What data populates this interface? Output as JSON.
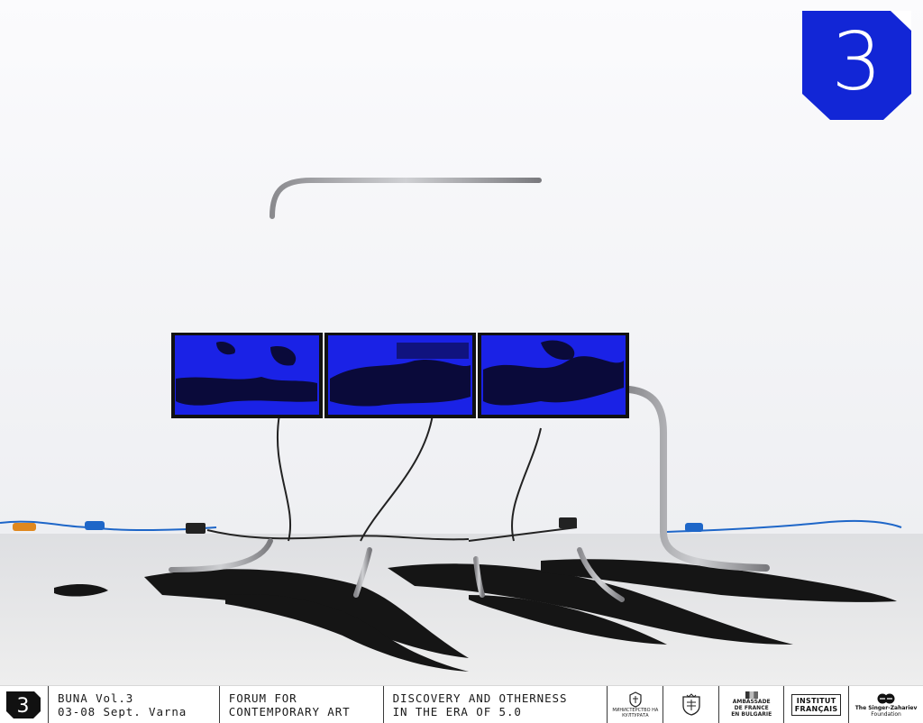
{
  "badge": {
    "number": "3",
    "color": "#1226d6"
  },
  "footer": {
    "logo_number": "3",
    "event": {
      "line1": "BUNA Vol.3",
      "line2": "03-08 Sept. Varna"
    },
    "forum": {
      "line1": "FORUM FOR",
      "line2": "CONTEMPORARY ART"
    },
    "theme": {
      "line1": "DISCOVERY AND OTHERNESS",
      "line2": "IN THE ERA OF 5.0"
    },
    "partners": {
      "ministry": "МИНИСТЕРСТВО НА КУЛТУРАТА",
      "municipality_icon": "varna-crest-icon",
      "embassy": {
        "line1": "AMBASSADE",
        "line2": "DE FRANCE",
        "line3": "EN BULGARIE"
      },
      "institut": {
        "line1": "INSTITUT",
        "line2": "FRANÇAIS"
      },
      "foundation": {
        "line1": "The Singer-Zahariev",
        "line2": "Foundation"
      }
    }
  },
  "colors": {
    "screen_blue": "#1a22e6",
    "accent": "#1226d6"
  }
}
